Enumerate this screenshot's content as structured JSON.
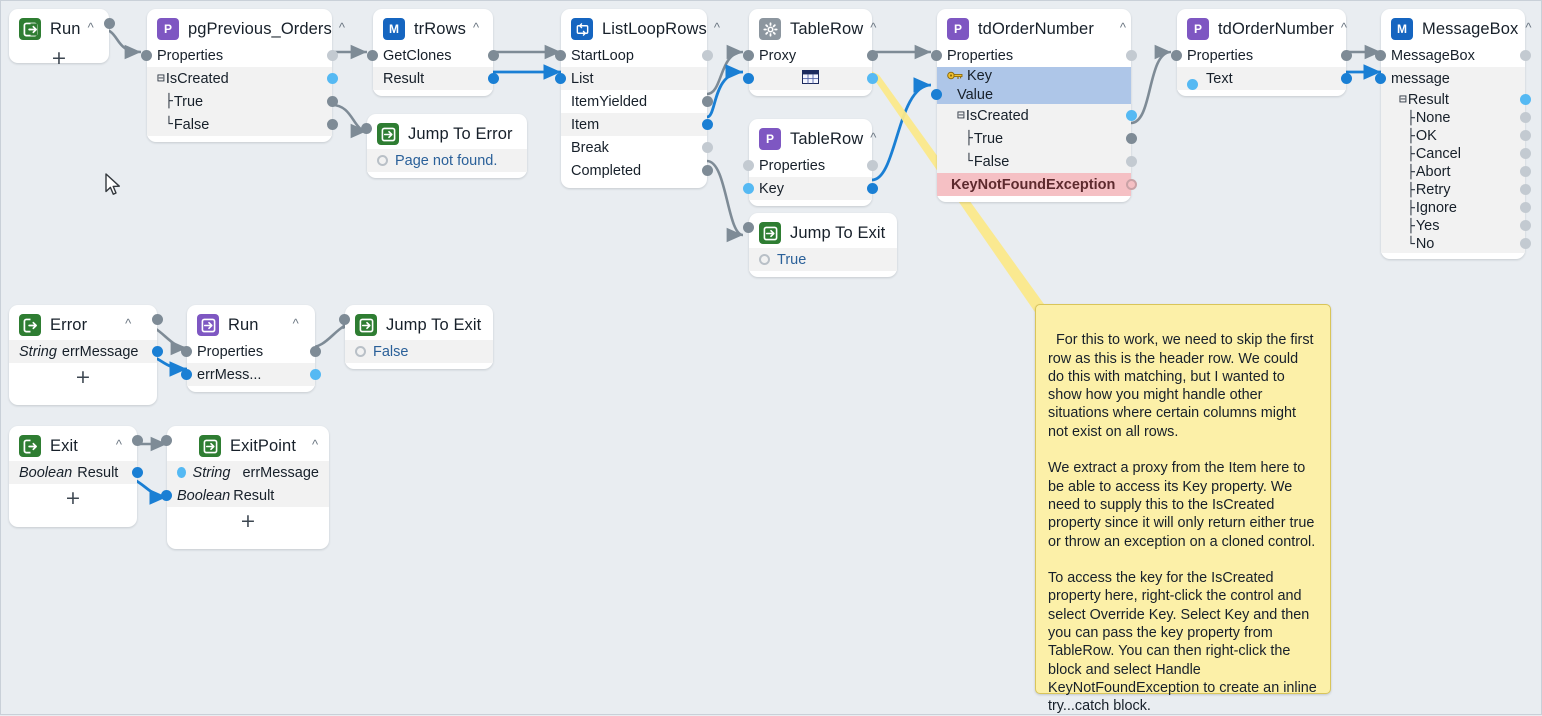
{
  "canvas": {
    "background": "#e9edf1",
    "accent_blue": "#1a7fd4",
    "accent_grey": "#7e8b96",
    "note_bg": "#fcf0a8",
    "exception_bg": "#f5c0c4",
    "selected_bg": "#aec6e8"
  },
  "nodes": [
    {
      "id": "run-entry",
      "title": "Run",
      "icon": "entry-point-icon",
      "icon_color": "#2e7d32",
      "rows": [],
      "plus": "+"
    },
    {
      "id": "pg-previous-orders",
      "title": "pgPrevious_Orders",
      "icon": "page-icon",
      "icon_letter": "P",
      "icon_color": "#7e57c2",
      "rows": [
        {
          "label": "Properties",
          "tree": "",
          "style": "plain"
        },
        {
          "label": "IsCreated",
          "tree": "minus-box",
          "style": "alt"
        },
        {
          "label": "True",
          "tree": "branch",
          "style": "alt"
        },
        {
          "label": "False",
          "tree": "branch-end",
          "style": "alt"
        }
      ]
    },
    {
      "id": "tr-rows",
      "title": "trRows",
      "icon": "module-icon",
      "icon_letter": "M",
      "icon_color": "#1565c0",
      "rows": [
        {
          "label": "GetClones",
          "style": "plain"
        },
        {
          "label": "Result",
          "style": "alt"
        }
      ]
    },
    {
      "id": "jump-to-error",
      "title": "Jump To Error",
      "icon": "jump-icon",
      "icon_color": "#2e7d32",
      "rows": [
        {
          "label": "Page not found.",
          "style": "alt-link"
        }
      ]
    },
    {
      "id": "list-loop-rows",
      "title": "ListLoopRows",
      "icon": "loop-icon",
      "icon_color": "#1565c0",
      "rows": [
        {
          "label": "StartLoop",
          "style": "plain"
        },
        {
          "label": "List",
          "style": "alt"
        },
        {
          "label": "ItemYielded",
          "style": "plain"
        },
        {
          "label": "Item",
          "style": "alt"
        },
        {
          "label": "Break",
          "style": "plain"
        },
        {
          "label": "Completed",
          "style": "plain"
        }
      ]
    },
    {
      "id": "table-row-proxy",
      "title": "TableRow",
      "icon": "gear-icon",
      "icon_color": "#8c969f",
      "rows": [
        {
          "label": "Proxy",
          "style": "plain"
        },
        {
          "label": "",
          "style": "alt-table-icon"
        }
      ]
    },
    {
      "id": "table-row-key",
      "title": "TableRow",
      "icon": "page-icon",
      "icon_letter": "P",
      "icon_color": "#7e57c2",
      "rows": [
        {
          "label": "Properties",
          "style": "plain"
        },
        {
          "label": "Key",
          "style": "alt"
        }
      ]
    },
    {
      "id": "jump-to-exit-loop",
      "title": "Jump To Exit",
      "icon": "jump-icon",
      "icon_color": "#2e7d32",
      "rows": [
        {
          "label": "True",
          "style": "alt-link"
        }
      ]
    },
    {
      "id": "td-order-number-key",
      "title": "tdOrderNumber",
      "icon": "page-icon",
      "icon_letter": "P",
      "icon_color": "#7e57c2",
      "rows": [
        {
          "label": "Properties",
          "style": "plain"
        },
        {
          "label": "Key",
          "style": "sel-key"
        },
        {
          "label": "Value",
          "style": "sel-value"
        },
        {
          "label": "IsCreated",
          "tree": "minus-box",
          "style": "alt"
        },
        {
          "label": "True",
          "tree": "branch",
          "style": "alt"
        },
        {
          "label": "False",
          "tree": "branch-end",
          "style": "alt"
        },
        {
          "label": "KeyNotFoundException",
          "style": "exception"
        }
      ]
    },
    {
      "id": "td-order-number-text",
      "title": "tdOrderNumber",
      "icon": "page-icon",
      "icon_letter": "P",
      "icon_color": "#7e57c2",
      "rows": [
        {
          "label": "Properties",
          "style": "plain"
        },
        {
          "label": "Text",
          "style": "alt"
        }
      ]
    },
    {
      "id": "message-box",
      "title": "MessageBox",
      "icon": "module-icon",
      "icon_letter": "M",
      "icon_color": "#1565c0",
      "rows": [
        {
          "label": "MessageBox",
          "style": "plain"
        },
        {
          "label": "message",
          "style": "alt"
        },
        {
          "label": "Result",
          "tree": "minus-box",
          "style": "alt"
        },
        {
          "label": "None",
          "tree": "branch",
          "style": "alt"
        },
        {
          "label": "OK",
          "tree": "branch",
          "style": "alt"
        },
        {
          "label": "Cancel",
          "tree": "branch",
          "style": "alt"
        },
        {
          "label": "Abort",
          "tree": "branch",
          "style": "alt"
        },
        {
          "label": "Retry",
          "tree": "branch",
          "style": "alt"
        },
        {
          "label": "Ignore",
          "tree": "branch",
          "style": "alt"
        },
        {
          "label": "Yes",
          "tree": "branch",
          "style": "alt"
        },
        {
          "label": "No",
          "tree": "branch-end",
          "style": "alt"
        }
      ]
    },
    {
      "id": "error-entry",
      "title": "Error",
      "icon": "entry-point-icon",
      "icon_color": "#2e7d32",
      "rows": [
        {
          "type_label": "String",
          "label": "errMessage",
          "style": "alt"
        }
      ],
      "plus": "+"
    },
    {
      "id": "run-sub",
      "title": "Run",
      "icon": "jump-icon",
      "icon_color": "#7e57c2",
      "rows": [
        {
          "label": "Properties",
          "style": "plain"
        },
        {
          "label": "errMess...",
          "style": "alt"
        }
      ]
    },
    {
      "id": "jump-to-exit-error",
      "title": "Jump To Exit",
      "icon": "jump-icon",
      "icon_color": "#2e7d32",
      "rows": [
        {
          "label": "False",
          "style": "alt-link"
        }
      ]
    },
    {
      "id": "exit-entry",
      "title": "Exit",
      "icon": "entry-point-icon",
      "icon_color": "#2e7d32",
      "rows": [
        {
          "type_label": "Boolean",
          "label": "Result",
          "style": "alt"
        }
      ],
      "plus": "+"
    },
    {
      "id": "exit-point",
      "title": "ExitPoint",
      "icon": "jump-icon",
      "icon_color": "#2e7d32",
      "rows": [
        {
          "type_label": "String",
          "label": "errMessage",
          "style": "alt"
        },
        {
          "type_label": "Boolean",
          "label": "Result",
          "style": "alt"
        }
      ],
      "plus": "+"
    }
  ],
  "note": {
    "id": "comment-note",
    "text": "For this to work, we need to skip the first row as this is the header row. We could do this with matching, but I wanted to show how you might handle other situations where certain columns might not exist on all rows.\n\nWe extract a proxy from the Item here to be able to access its Key property. We need to supply this to the IsCreated property since it will only return either true or throw an exception on a cloned control.\n\nTo access the key for the IsCreated property here, right-click the control and select Override Key. Select Key and then you can pass the key property from TableRow. You can then right-click the block and select Handle KeyNotFoundException to create an inline try...catch block."
  }
}
